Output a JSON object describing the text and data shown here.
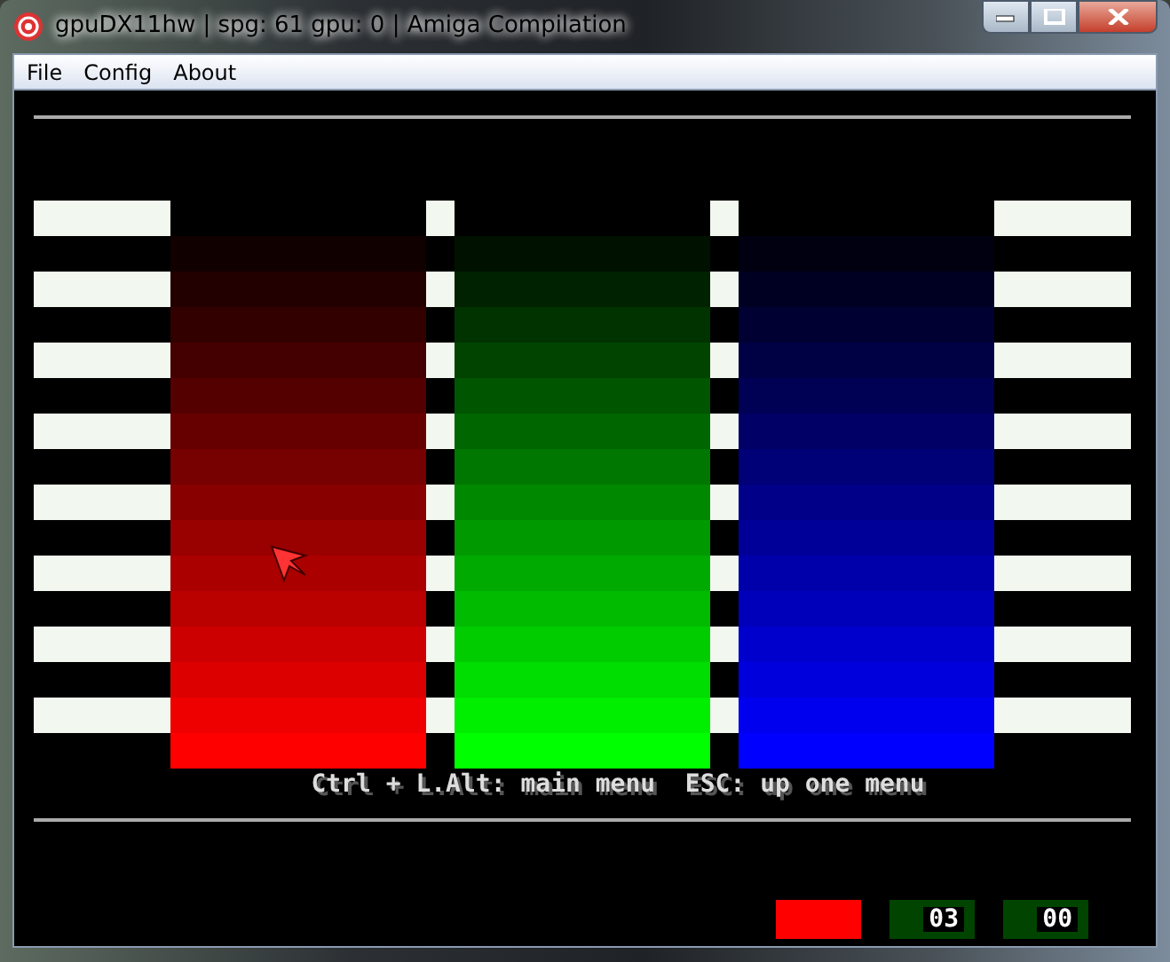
{
  "window": {
    "title": "gpuDX11hw | spg: 61 gpu: 0 | Amiga Compilation"
  },
  "menu": [
    "File",
    "Config",
    "About"
  ],
  "screen": {
    "columns": [
      {
        "color": "#ff0000"
      },
      {
        "color": "#00ff00"
      },
      {
        "color": "#0000ff"
      }
    ],
    "hint": "Ctrl + L.Alt: main menu  ESC: up one menu"
  },
  "status": {
    "power_led": {
      "on": true
    },
    "counters": [
      "03",
      "00"
    ]
  }
}
